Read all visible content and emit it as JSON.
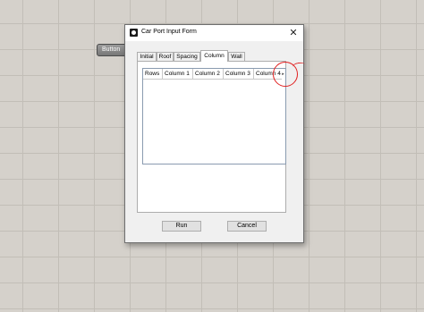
{
  "canvas": {
    "button_label": "Button"
  },
  "dialog": {
    "title": "Car Port Input Form",
    "close_glyph": "✕",
    "tabs": [
      {
        "label": "Initial"
      },
      {
        "label": "Roof"
      },
      {
        "label": "Spacing"
      },
      {
        "label": "Column"
      },
      {
        "label": "Wall"
      }
    ],
    "active_tab": "Column",
    "grid": {
      "headers": [
        "Rows",
        "Column 1",
        "Column 2",
        "Column 3",
        "Column 4"
      ],
      "scroll_glyph": "▸"
    },
    "run_label": "Run",
    "cancel_label": "Cancel"
  },
  "annotation_color": "#e02020"
}
